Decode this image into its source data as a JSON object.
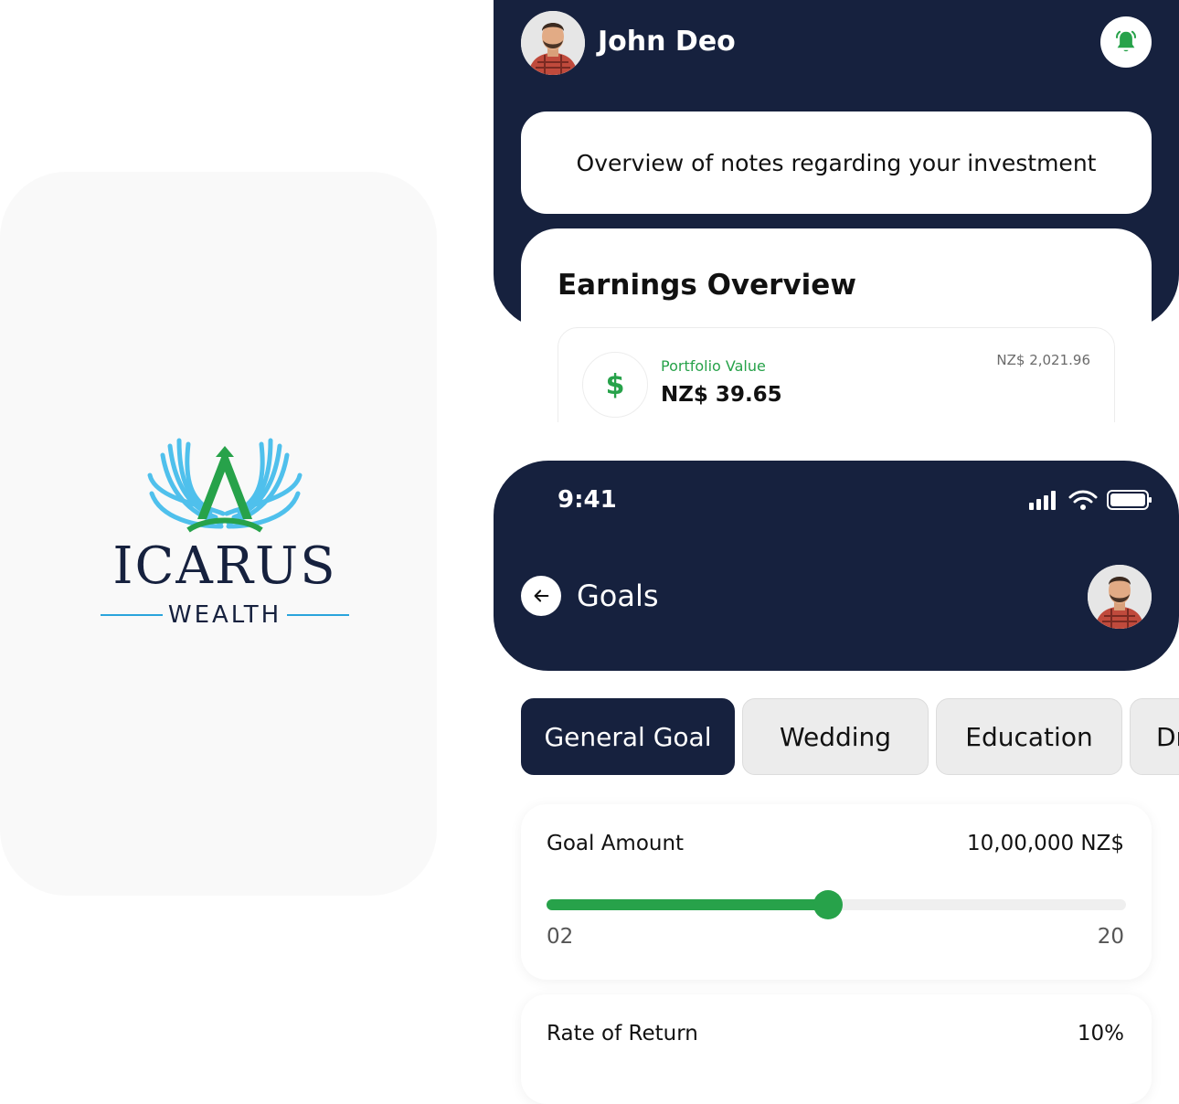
{
  "logo": {
    "wordmark": "ICARUS",
    "subtitle": "WEALTH"
  },
  "dashboard": {
    "user_name": "John Deo",
    "notes_banner": "Overview of notes regarding your investment",
    "earnings_title": "Earnings Overview",
    "portfolio_label": "Portfolio Value",
    "portfolio_value": "NZ$ 39.65",
    "portfolio_total": "NZ$ 2,021.96",
    "currency_symbol": "$"
  },
  "goals": {
    "status_time": "9:41",
    "title": "Goals",
    "tabs": [
      {
        "label": "General Goal",
        "active": true
      },
      {
        "label": "Wedding",
        "active": false
      },
      {
        "label": "Education",
        "active": false
      },
      {
        "label": "Dr",
        "active": false
      }
    ],
    "goal_amount_label": "Goal Amount",
    "goal_amount_value": "10,00,000 NZ$",
    "slider_min": "02",
    "slider_max": "20",
    "slider_level": 0.486,
    "rate_label": "Rate of Return",
    "rate_value": "10%"
  },
  "colors": {
    "navy": "#16213e",
    "green": "#27a24a",
    "sky": "#2aa4dc"
  }
}
